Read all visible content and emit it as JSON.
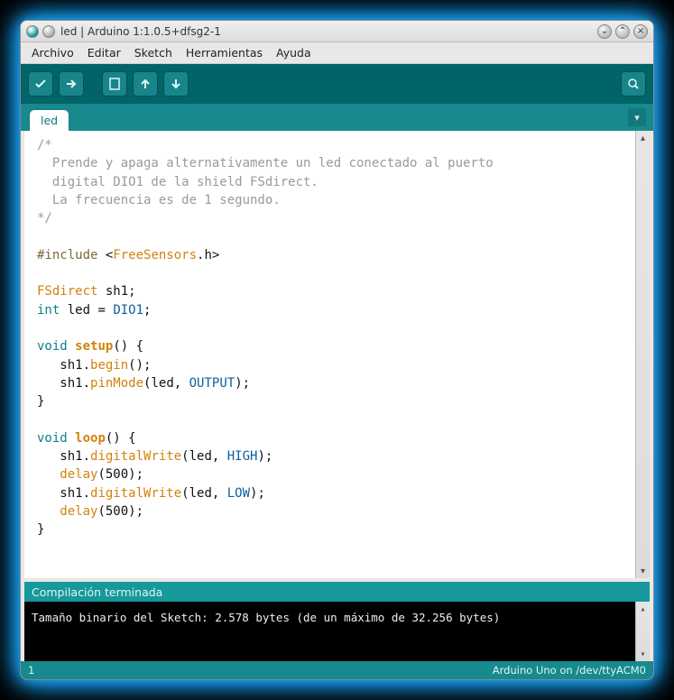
{
  "window": {
    "title": "led | Arduino 1:1.0.5+dfsg2-1"
  },
  "menu": {
    "archivo": "Archivo",
    "editar": "Editar",
    "sketch": "Sketch",
    "herramientas": "Herramientas",
    "ayuda": "Ayuda"
  },
  "tab": {
    "name": "led"
  },
  "code": {
    "c1": "/*",
    "c2": "  Prende y apaga alternativamente un led conectado al puerto",
    "c3": "  digital DIO1 de la shield FSdirect.",
    "c4": "  La frecuencia es de 1 segundo.",
    "c5": "*/",
    "inc1": "#include ",
    "inc2": "<",
    "inc3": "FreeSensors",
    "inc4": ".h>",
    "d1a": "FSdirect",
    "d1b": " sh1;",
    "d2a": "int",
    "d2b": " led = ",
    "d2c": "DIO1",
    "d2d": ";",
    "s1a": "void",
    "s1b": " ",
    "s1c": "setup",
    "s1d": "() {",
    "s2a": "   sh1.",
    "s2b": "begin",
    "s2c": "();",
    "s3a": "   sh1.",
    "s3b": "pinMode",
    "s3c": "(led, ",
    "s3d": "OUTPUT",
    "s3e": ");",
    "s4": "}",
    "l1a": "void",
    "l1b": " ",
    "l1c": "loop",
    "l1d": "() {",
    "l2a": "   sh1.",
    "l2b": "digitalWrite",
    "l2c": "(led, ",
    "l2d": "HIGH",
    "l2e": ");",
    "l3a": "   ",
    "l3b": "delay",
    "l3c": "(500);",
    "l4a": "   sh1.",
    "l4b": "digitalWrite",
    "l4c": "(led, ",
    "l4d": "LOW",
    "l4e": ");",
    "l5a": "   ",
    "l5b": "delay",
    "l5c": "(500);",
    "l6": "}"
  },
  "status": {
    "text": "Compilación terminada"
  },
  "console": {
    "line": "Tamaño binario del Sketch: 2.578 bytes (de un máximo de 32.256 bytes)"
  },
  "footer": {
    "left": "1",
    "right": "Arduino Uno on /dev/ttyACM0"
  }
}
